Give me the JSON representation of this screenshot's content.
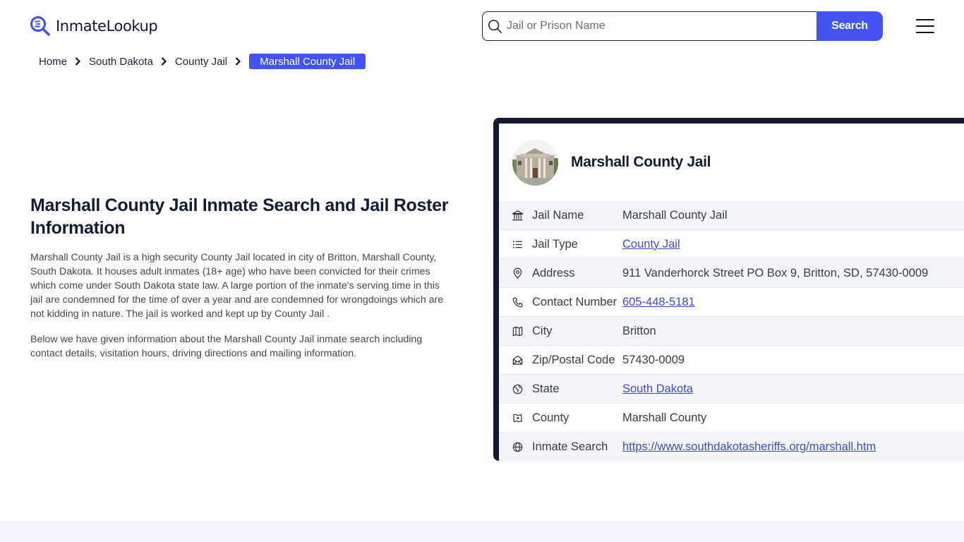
{
  "header": {
    "logo_text": "InmateLookup",
    "search": {
      "placeholder": "Jail or Prison Name",
      "value": "",
      "button_label": "Search"
    },
    "menu_icon": "hamburger-icon"
  },
  "breadcrumb": {
    "items": [
      {
        "label": "Home"
      },
      {
        "label": "South Dakota"
      },
      {
        "label": "County Jail"
      }
    ],
    "current": "Marshall County Jail"
  },
  "main": {
    "title": "Marshall County Jail Inmate Search and Jail Roster Information",
    "paragraphs": [
      "Marshall County Jail is a high security County Jail located in city of Britton, Marshall County, South Dakota. It houses adult inmates (18+ age) who have been convicted for their crimes which come under South Dakota state law. A large portion of the inmate's serving time in this jail are condemned for the time of over a year and are condemned for wrongdoings which are not kidding in nature. The jail is worked and kept up by County Jail .",
      "Below we have given information about the Marshall County Jail inmate search including contact details, visitation hours, driving directions and mailing information."
    ]
  },
  "card": {
    "title": "Marshall County Jail",
    "rows": [
      {
        "icon": "building-columns-icon",
        "label": "Jail Name",
        "value": "Marshall County Jail",
        "link": false
      },
      {
        "icon": "list-icon",
        "label": "Jail Type",
        "value": "County Jail",
        "link": true
      },
      {
        "icon": "map-pin-icon",
        "label": "Address",
        "value": "911 Vanderhorck Street PO Box 9, Britton, SD, 57430-0009",
        "link": false
      },
      {
        "icon": "phone-icon",
        "label": "Contact Number",
        "value": "605-448-5181",
        "link": true
      },
      {
        "icon": "map-icon",
        "label": "City",
        "value": "Britton",
        "link": false
      },
      {
        "icon": "mail-open-icon",
        "label": "Zip/Postal Code",
        "value": "57430-0009",
        "link": false
      },
      {
        "icon": "globe-map-icon",
        "label": "State",
        "value": "South Dakota",
        "link": true
      },
      {
        "icon": "county-map-icon",
        "label": "County",
        "value": "Marshall County",
        "link": false
      },
      {
        "icon": "globe-icon",
        "label": "Inmate Search",
        "value": "https://www.southdakotasheriffs.org/marshall.htm",
        "link": true
      }
    ]
  },
  "colors": {
    "accent": "#4353f4",
    "card_border": "#111a2e",
    "link": "#3f4bd6",
    "row_alt": "#f4f5fb"
  }
}
